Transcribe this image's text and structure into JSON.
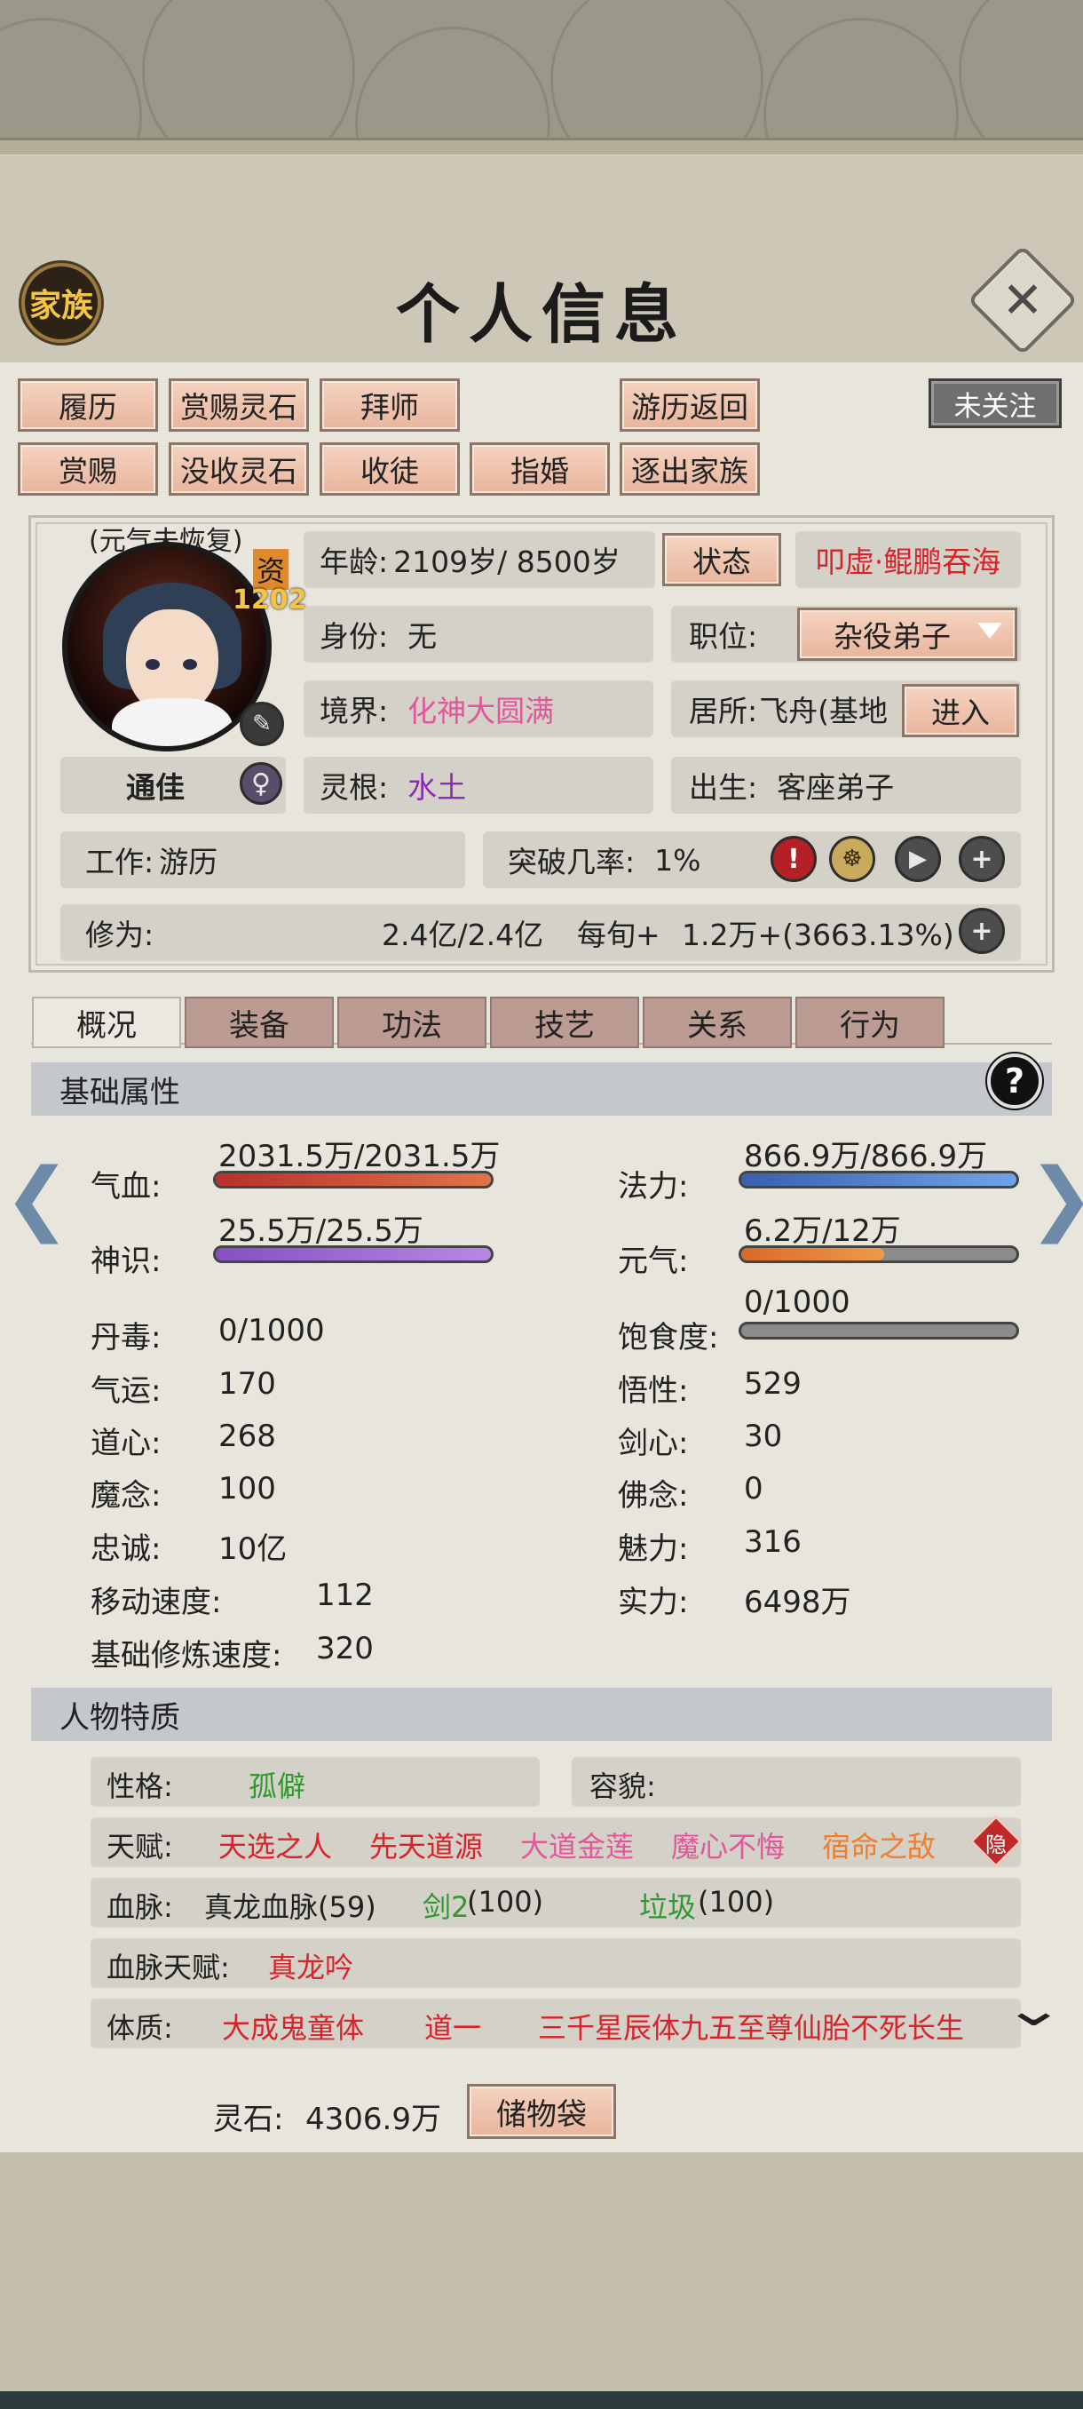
{
  "header": {
    "title": "个人信息",
    "clan_label": "家族",
    "close_label": "✕"
  },
  "actions": {
    "row1": [
      "履历",
      "赏赐灵石",
      "拜师",
      "游历返回"
    ],
    "row2": [
      "赏赐",
      "没收灵石",
      "收徒",
      "指婚",
      "逐出家族"
    ],
    "follow": "未关注"
  },
  "profile": {
    "vitality_note": "(元气未恢复)",
    "aptitude_label": "资",
    "aptitude_value": "1202",
    "name_or_status": "通佳",
    "gender_icon": "♀",
    "age_label": "年龄:",
    "age_value": "2109岁/ 8500岁",
    "status_btn": "状态",
    "skill_name": "叩虚·鲲鹏吞海",
    "identity_label": "身份:",
    "identity_value": "无",
    "position_label": "职位:",
    "position_value": "杂役弟子",
    "realm_label": "境界:",
    "realm_value": "化神大圆满",
    "residence_label": "居所:",
    "residence_value": "飞舟(基地",
    "enter_btn": "进入",
    "root_label": "灵根:",
    "root_value": "水土",
    "birth_label": "出生:",
    "birth_value": "客座弟子",
    "work_label": "工作:",
    "work_value": "游历",
    "breakthrough_label": "突破几率:",
    "breakthrough_value": "1%",
    "cultivation_label": "修为:",
    "cultivation_value": "2.4亿/2.4亿",
    "per_tick_label": "每旬+",
    "per_tick_value": "1.2万+(3663.13%)",
    "plus_icon": "+"
  },
  "tabs": [
    "概况",
    "装备",
    "功法",
    "技艺",
    "关系",
    "行为"
  ],
  "basic": {
    "title": "基础属性",
    "help": "?",
    "hp_label": "气血:",
    "hp_value": "2031.5万/2031.5万",
    "hp_ratio": 1.0,
    "mana_label": "法力:",
    "mana_value": "866.9万/866.9万",
    "mana_ratio": 1.0,
    "sense_label": "神识:",
    "sense_value": "25.5万/25.5万",
    "sense_ratio": 1.0,
    "vital_label": "元气:",
    "vital_value": "6.2万/12万",
    "vital_ratio": 0.52,
    "poison_label": "丹毒:",
    "poison_value": "0/1000",
    "satiety_label": "饱食度:",
    "satiety_value": "0/1000",
    "satiety_ratio": 0.0,
    "luck_label": "气运:",
    "luck_value": "170",
    "insight_label": "悟性:",
    "insight_value": "529",
    "dao_label": "道心:",
    "dao_value": "268",
    "sword_label": "剑心:",
    "sword_value": "30",
    "demon_label": "魔念:",
    "demon_value": "100",
    "buddha_label": "佛念:",
    "buddha_value": "0",
    "loyalty_label": "忠诚:",
    "loyalty_value": "10亿",
    "charm_label": "魅力:",
    "charm_value": "316",
    "speed_label": "移动速度:",
    "speed_value": "112",
    "power_label": "实力:",
    "power_value": "6498万",
    "train_label": "基础修炼速度:",
    "train_value": "320"
  },
  "traits": {
    "title": "人物特质",
    "personality_label": "性格:",
    "personality_value": "孤僻",
    "looks_label": "容貌:",
    "talent_label": "天赋:",
    "talents": [
      "天选之人",
      "先天道源",
      "大道金莲",
      "魔心不悔",
      "宿命之敌"
    ],
    "hide_label": "隐",
    "blood_label": "血脉:",
    "blood_main": "真龙血脉(59)",
    "blood_sword_name": "剑2",
    "blood_sword_num": "(100)",
    "blood_trash_name": "垃圾",
    "blood_trash_num": "(100)",
    "blood_talent_label": "血脉天赋:",
    "blood_talent_value": "真龙吟",
    "physique_label": "体质:",
    "physique_values": [
      "大成鬼童体",
      "道一",
      "三千星辰体九五至尊仙胎不死长生"
    ]
  },
  "footer": {
    "spirit_stone_label": "灵石:",
    "spirit_stone_value": "4306.9万",
    "storage_btn": "储物袋"
  },
  "colors": {
    "red_text": "#d8232a",
    "pink_text": "#e2569b",
    "purple_text": "#8a2cb3",
    "green_text": "#2e9a2e",
    "orange_text": "#ef7d2c",
    "hp_bar": "#b8302c",
    "mana_bar": "#4b7fd4",
    "sense_bar": "#9b66d6",
    "vital_bar": "#e17a2f"
  }
}
